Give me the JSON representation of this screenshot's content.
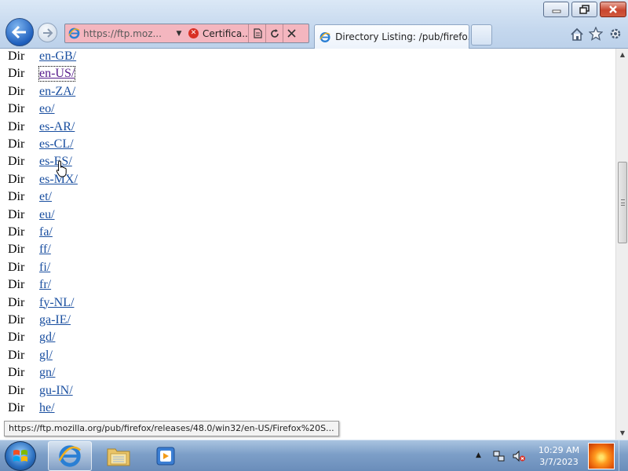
{
  "browser": {
    "address_url": "https://ftp.moz...",
    "address_url_bold": "",
    "cert_error_label": "Certifica...",
    "tab_title": "Directory Listing: /pub/firefo..."
  },
  "listing": [
    {
      "type": "Dir",
      "name": "en-GB/"
    },
    {
      "type": "Dir",
      "name": "en-US/"
    },
    {
      "type": "Dir",
      "name": "en-ZA/"
    },
    {
      "type": "Dir",
      "name": "eo/"
    },
    {
      "type": "Dir",
      "name": "es-AR/"
    },
    {
      "type": "Dir",
      "name": "es-CL/"
    },
    {
      "type": "Dir",
      "name": "es-ES/"
    },
    {
      "type": "Dir",
      "name": "es-MX/"
    },
    {
      "type": "Dir",
      "name": "et/"
    },
    {
      "type": "Dir",
      "name": "eu/"
    },
    {
      "type": "Dir",
      "name": "fa/"
    },
    {
      "type": "Dir",
      "name": "ff/"
    },
    {
      "type": "Dir",
      "name": "fi/"
    },
    {
      "type": "Dir",
      "name": "fr/"
    },
    {
      "type": "Dir",
      "name": "fy-NL/"
    },
    {
      "type": "Dir",
      "name": "ga-IE/"
    },
    {
      "type": "Dir",
      "name": "gd/"
    },
    {
      "type": "Dir",
      "name": "gl/"
    },
    {
      "type": "Dir",
      "name": "gn/"
    },
    {
      "type": "Dir",
      "name": "gu-IN/"
    },
    {
      "type": "Dir",
      "name": "he/"
    }
  ],
  "focused_item": "en-US/",
  "status_url": "https://ftp.mozilla.org/pub/firefox/releases/48.0/win32/en-US/Firefox%20S...",
  "taskbar": {
    "time": "10:29 AM",
    "date": "3/7/2023"
  },
  "icons": {
    "back": "back-arrow-icon",
    "forward": "forward-arrow-icon",
    "home": "home-icon",
    "favorites": "star-icon",
    "tools": "gear-icon",
    "cert_error": "error-x-icon"
  },
  "colors": {
    "address_bar_error": "#f4b6bf",
    "link": "#1a4fa0",
    "visited_focus": "#551a8b"
  }
}
